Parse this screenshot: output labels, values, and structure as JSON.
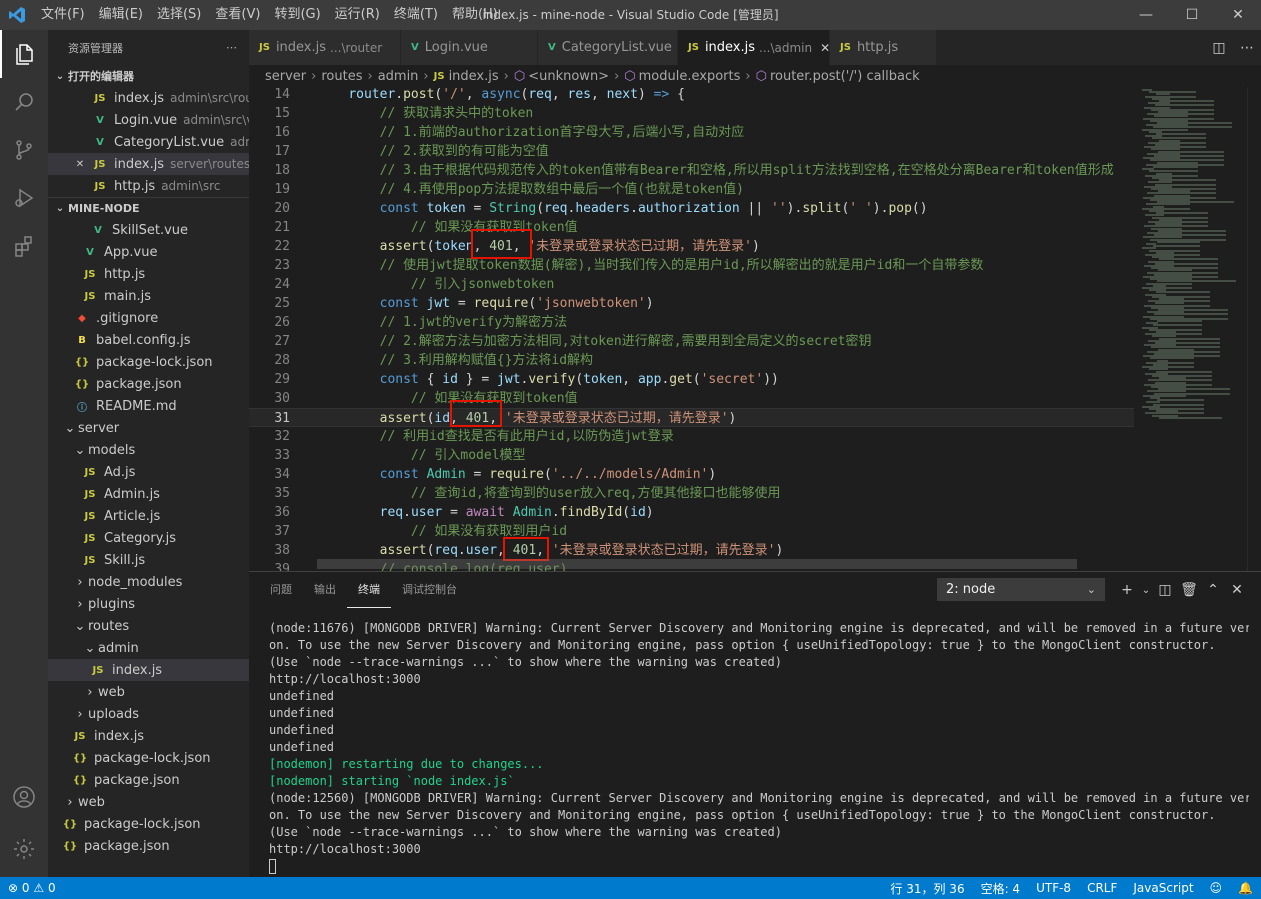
{
  "titlebar": {
    "menus": [
      "文件(F)",
      "编辑(E)",
      "选择(S)",
      "查看(V)",
      "转到(G)",
      "运行(R)",
      "终端(T)",
      "帮助(H)"
    ],
    "title": "index.js - mine-node - Visual Studio Code [管理员]"
  },
  "sidebar": {
    "header": "资源管理器",
    "open_editors_title": "打开的编辑器",
    "open_editors": [
      {
        "name": "index.js",
        "desc": "admin\\src\\router",
        "type": "js"
      },
      {
        "name": "Login.vue",
        "desc": "admin\\src\\vi...",
        "type": "vue"
      },
      {
        "name": "CategoryList.vue",
        "desc": "adm...",
        "type": "vue"
      },
      {
        "name": "index.js",
        "desc": "server\\routes\\a...",
        "type": "js"
      },
      {
        "name": "http.js",
        "desc": "admin\\src",
        "type": "js"
      }
    ],
    "project_title": "MINE-NODE",
    "tree": [
      {
        "name": "SkillSet.vue",
        "type": "vue",
        "indent": 42
      },
      {
        "name": "App.vue",
        "type": "vue",
        "indent": 34
      },
      {
        "name": "http.js",
        "type": "js",
        "indent": 34
      },
      {
        "name": "main.js",
        "type": "js",
        "indent": 34
      },
      {
        "name": ".gitignore",
        "type": "git",
        "indent": 26
      },
      {
        "name": "babel.config.js",
        "type": "babel",
        "indent": 26
      },
      {
        "name": "package-lock.json",
        "type": "json",
        "indent": 26
      },
      {
        "name": "package.json",
        "type": "json",
        "indent": 26
      },
      {
        "name": "README.md",
        "type": "md",
        "indent": 26
      },
      {
        "name": "server",
        "type": "folder-open",
        "indent": 14
      },
      {
        "name": "models",
        "type": "folder-open",
        "indent": 24
      },
      {
        "name": "Ad.js",
        "type": "js",
        "indent": 34
      },
      {
        "name": "Admin.js",
        "type": "js",
        "indent": 34
      },
      {
        "name": "Article.js",
        "type": "js",
        "indent": 34
      },
      {
        "name": "Category.js",
        "type": "js",
        "indent": 34
      },
      {
        "name": "Skill.js",
        "type": "js",
        "indent": 34
      },
      {
        "name": "node_modules",
        "type": "folder",
        "indent": 24
      },
      {
        "name": "plugins",
        "type": "folder",
        "indent": 24
      },
      {
        "name": "routes",
        "type": "folder-open",
        "indent": 24
      },
      {
        "name": "admin",
        "type": "folder-open",
        "indent": 34
      },
      {
        "name": "index.js",
        "type": "js",
        "indent": 42,
        "selected": true
      },
      {
        "name": "web",
        "type": "folder",
        "indent": 34
      },
      {
        "name": "uploads",
        "type": "folder",
        "indent": 24
      },
      {
        "name": "index.js",
        "type": "js",
        "indent": 24
      },
      {
        "name": "package-lock.json",
        "type": "json",
        "indent": 24
      },
      {
        "name": "package.json",
        "type": "json",
        "indent": 24
      },
      {
        "name": "web",
        "type": "folder",
        "indent": 14
      },
      {
        "name": "package-lock.json",
        "type": "json",
        "indent": 14
      },
      {
        "name": "package.json",
        "type": "json",
        "indent": 14
      }
    ]
  },
  "tabs": [
    {
      "name": "index.js",
      "desc": "...\\router",
      "type": "js",
      "active": false
    },
    {
      "name": "Login.vue",
      "desc": "",
      "type": "vue",
      "active": false
    },
    {
      "name": "CategoryList.vue",
      "desc": "",
      "type": "vue",
      "active": false
    },
    {
      "name": "index.js",
      "desc": "...\\admin",
      "type": "js",
      "active": true
    },
    {
      "name": "http.js",
      "desc": "",
      "type": "js",
      "active": false
    }
  ],
  "breadcrumb": {
    "parts": [
      "server",
      "routes",
      "admin"
    ],
    "file": "index.js",
    "symbols": [
      "<unknown>",
      "module.exports",
      "router.post('/') callback"
    ]
  },
  "code": [
    {
      "n": "14",
      "t": [
        [
          "p",
          "    "
        ],
        [
          "v",
          "router"
        ],
        [
          "p",
          "."
        ],
        [
          "f",
          "post"
        ],
        [
          "p",
          "("
        ],
        [
          "s",
          "'/'"
        ],
        [
          "p",
          ", "
        ],
        [
          "k",
          "async"
        ],
        [
          "p",
          "("
        ],
        [
          "v",
          "req"
        ],
        [
          "p",
          ", "
        ],
        [
          "v",
          "res"
        ],
        [
          "p",
          ", "
        ],
        [
          "v",
          "next"
        ],
        [
          "p",
          ") "
        ],
        [
          "k",
          "=>"
        ],
        [
          "p",
          " {"
        ]
      ]
    },
    {
      "n": "15",
      "t": [
        [
          "c",
          "        // 获取请求头中的token"
        ]
      ]
    },
    {
      "n": "16",
      "t": [
        [
          "c",
          "        // 1.前端的authorization首字母大写,后端小写,自动对应"
        ]
      ]
    },
    {
      "n": "17",
      "t": [
        [
          "c",
          "        // 2.获取到的有可能为空值"
        ]
      ]
    },
    {
      "n": "18",
      "t": [
        [
          "c",
          "        // 3.由于根据代码规范传入的token值带有Bearer和空格,所以用split方法找到空格,在空格处分离Bearer和token值形成"
        ]
      ]
    },
    {
      "n": "19",
      "t": [
        [
          "c",
          "        // 4.再使用pop方法提取数组中最后一个值(也就是token值)"
        ]
      ]
    },
    {
      "n": "20",
      "t": [
        [
          "p",
          "        "
        ],
        [
          "k",
          "const "
        ],
        [
          "v",
          "token"
        ],
        [
          "p",
          " = "
        ],
        [
          "cls",
          "String"
        ],
        [
          "p",
          "("
        ],
        [
          "v",
          "req"
        ],
        [
          "p",
          "."
        ],
        [
          "v",
          "headers"
        ],
        [
          "p",
          "."
        ],
        [
          "v",
          "authorization"
        ],
        [
          "p",
          " || "
        ],
        [
          "s",
          "''"
        ],
        [
          "p",
          ")."
        ],
        [
          "f",
          "split"
        ],
        [
          "p",
          "("
        ],
        [
          "s",
          "' '"
        ],
        [
          "p",
          ")."
        ],
        [
          "f",
          "pop"
        ],
        [
          "p",
          "()"
        ]
      ]
    },
    {
      "n": "21",
      "t": [
        [
          "c",
          "            // 如果没有获取到token值"
        ]
      ]
    },
    {
      "n": "22",
      "t": [
        [
          "p",
          "        "
        ],
        [
          "f",
          "assert"
        ],
        [
          "p",
          "("
        ],
        [
          "v",
          "token"
        ],
        [
          "p",
          ", "
        ],
        [
          "n",
          "401"
        ],
        [
          "p",
          ", "
        ],
        [
          "s",
          "'未登录或登录状态已过期，请先登录'"
        ],
        [
          "p",
          ")"
        ]
      ]
    },
    {
      "n": "23",
      "t": [
        [
          "c",
          "        // 使用jwt提取token数据(解密),当时我们传入的是用户id,所以解密出的就是用户id和一个自带参数"
        ]
      ]
    },
    {
      "n": "24",
      "t": [
        [
          "c",
          "            // 引入jsonwebtoken"
        ]
      ]
    },
    {
      "n": "25",
      "t": [
        [
          "p",
          "        "
        ],
        [
          "k",
          "const "
        ],
        [
          "v",
          "jwt"
        ],
        [
          "p",
          " = "
        ],
        [
          "f",
          "require"
        ],
        [
          "p",
          "("
        ],
        [
          "s",
          "'jsonwebtoken'"
        ],
        [
          "p",
          ")"
        ]
      ]
    },
    {
      "n": "26",
      "t": [
        [
          "c",
          "        // 1.jwt的verify为解密方法"
        ]
      ]
    },
    {
      "n": "27",
      "t": [
        [
          "c",
          "        // 2.解密方法与加密方法相同,对token进行解密,需要用到全局定义的secret密钥"
        ]
      ]
    },
    {
      "n": "28",
      "t": [
        [
          "c",
          "        // 3.利用解构赋值{}方法将id解构"
        ]
      ]
    },
    {
      "n": "29",
      "t": [
        [
          "p",
          "        "
        ],
        [
          "k",
          "const "
        ],
        [
          "p",
          "{ "
        ],
        [
          "v",
          "id"
        ],
        [
          "p",
          " } = "
        ],
        [
          "v",
          "jwt"
        ],
        [
          "p",
          "."
        ],
        [
          "f",
          "verify"
        ],
        [
          "p",
          "("
        ],
        [
          "v",
          "token"
        ],
        [
          "p",
          ", "
        ],
        [
          "v",
          "app"
        ],
        [
          "p",
          "."
        ],
        [
          "f",
          "get"
        ],
        [
          "p",
          "("
        ],
        [
          "s",
          "'secret'"
        ],
        [
          "p",
          "))"
        ]
      ]
    },
    {
      "n": "30",
      "t": [
        [
          "c",
          "            // 如果没有获取到token值"
        ]
      ]
    },
    {
      "n": "31",
      "t": [
        [
          "p",
          "        "
        ],
        [
          "f",
          "assert"
        ],
        [
          "p",
          "("
        ],
        [
          "v",
          "id"
        ],
        [
          "p",
          ", "
        ],
        [
          "n",
          "401"
        ],
        [
          "p",
          ", "
        ],
        [
          "s",
          "'未登录或登录状态已过期，请先登录'"
        ],
        [
          "p",
          ")"
        ]
      ]
    },
    {
      "n": "32",
      "t": [
        [
          "c",
          "        // 利用id查找是否有此用户id,以防伪造jwt登录"
        ]
      ]
    },
    {
      "n": "33",
      "t": [
        [
          "c",
          "            // 引入model模型"
        ]
      ]
    },
    {
      "n": "34",
      "t": [
        [
          "p",
          "        "
        ],
        [
          "k",
          "const "
        ],
        [
          "cls",
          "Admin"
        ],
        [
          "p",
          " = "
        ],
        [
          "f",
          "require"
        ],
        [
          "p",
          "("
        ],
        [
          "s",
          "'../../models/Admin'"
        ],
        [
          "p",
          ")"
        ]
      ]
    },
    {
      "n": "35",
      "t": [
        [
          "c",
          "            // 查询id,将查询到的user放入req,方便其他接口也能够使用"
        ]
      ]
    },
    {
      "n": "36",
      "t": [
        [
          "p",
          "        "
        ],
        [
          "v",
          "req"
        ],
        [
          "p",
          "."
        ],
        [
          "v",
          "user"
        ],
        [
          "p",
          " = "
        ],
        [
          "kw2",
          "await "
        ],
        [
          "cls",
          "Admin"
        ],
        [
          "p",
          "."
        ],
        [
          "f",
          "findById"
        ],
        [
          "p",
          "("
        ],
        [
          "v",
          "id"
        ],
        [
          "p",
          ")"
        ]
      ]
    },
    {
      "n": "37",
      "t": [
        [
          "c",
          "            // 如果没有获取到用户id"
        ]
      ]
    },
    {
      "n": "38",
      "t": [
        [
          "p",
          "        "
        ],
        [
          "f",
          "assert"
        ],
        [
          "p",
          "("
        ],
        [
          "v",
          "req"
        ],
        [
          "p",
          "."
        ],
        [
          "v",
          "user"
        ],
        [
          "p",
          ", "
        ],
        [
          "n",
          "401"
        ],
        [
          "p",
          ", "
        ],
        [
          "s",
          "'未登录或登录状态已过期，请先登录'"
        ],
        [
          "p",
          ")"
        ]
      ]
    },
    {
      "n": "39",
      "t": [
        [
          "c",
          "        // console.log(req.user)"
        ]
      ]
    }
  ],
  "cursor_line": "31",
  "panel": {
    "tabs": [
      "问题",
      "输出",
      "终端",
      "调试控制台"
    ],
    "active_tab": "终端",
    "terminal_select": "2: node",
    "lines": [
      {
        "t": "(node:11676) [MONGODB DRIVER] Warning: Current Server Discovery and Monitoring engine is deprecated, and will be removed in a future versi",
        "c": ""
      },
      {
        "t": "on. To use the new Server Discovery and Monitoring engine, pass option { useUnifiedTopology: true } to the MongoClient constructor.",
        "c": ""
      },
      {
        "t": "(Use `node --trace-warnings ...` to show where the warning was created)",
        "c": ""
      },
      {
        "t": "http://localhost:3000",
        "c": ""
      },
      {
        "t": "undefined",
        "c": ""
      },
      {
        "t": "undefined",
        "c": ""
      },
      {
        "t": "undefined",
        "c": ""
      },
      {
        "t": "undefined",
        "c": ""
      },
      {
        "t": "[nodemon] restarting due to changes...",
        "c": "g"
      },
      {
        "t": "[nodemon] starting `node index.js`",
        "c": "g"
      },
      {
        "t": "(node:12560) [MONGODB DRIVER] Warning: Current Server Discovery and Monitoring engine is deprecated, and will be removed in a future versi",
        "c": ""
      },
      {
        "t": "on. To use the new Server Discovery and Monitoring engine, pass option { useUnifiedTopology: true } to the MongoClient constructor.",
        "c": ""
      },
      {
        "t": "(Use `node --trace-warnings ...` to show where the warning was created)",
        "c": ""
      },
      {
        "t": "http://localhost:3000",
        "c": ""
      }
    ]
  },
  "statusbar": {
    "errors": "0",
    "warnings": "0",
    "position": "行 31，列 36",
    "spaces": "空格: 4",
    "encoding": "UTF-8",
    "eol": "CRLF",
    "language": "JavaScript"
  }
}
